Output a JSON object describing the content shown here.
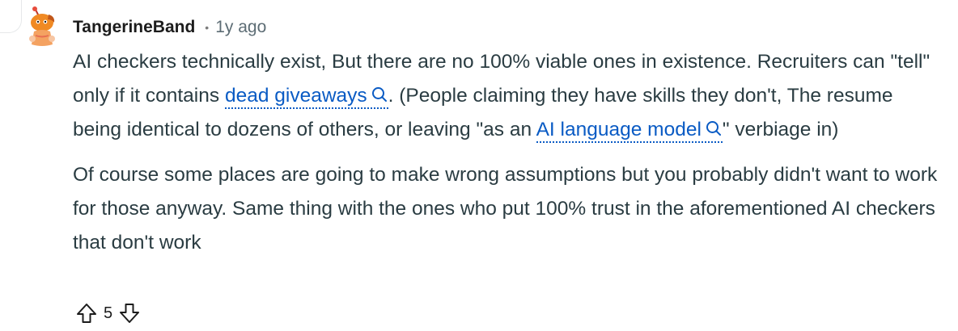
{
  "comment": {
    "username": "TangerineBand",
    "separator": "•",
    "time": "1y ago",
    "paragraph1": {
      "part1": "AI checkers technically exist, But there are no 100% viable ones in existence. Recruiters can \"tell\" only if it contains ",
      "link1": "dead giveaways",
      "part2": ". (People claiming they have skills they don't, The resume being identical to dozens of others, or leaving \"as an ",
      "link2": "AI language model",
      "part3": "\" verbiage in)"
    },
    "paragraph2": "Of course some places are going to make wrong assumptions but you probably didn't want to work for those anyway. Same thing with the ones who put 100% trust in the aforementioned AI checkers that don't work",
    "score": "5"
  },
  "colors": {
    "link": "#0a5bc4",
    "text": "#2a3c42",
    "meta": "#5c6c74",
    "avatar_body": "#f08a24"
  },
  "icons": {
    "avatar": "reddit-snoo-avatar",
    "search": "search-icon",
    "upvote": "upvote-arrow-icon",
    "downvote": "downvote-arrow-icon"
  }
}
